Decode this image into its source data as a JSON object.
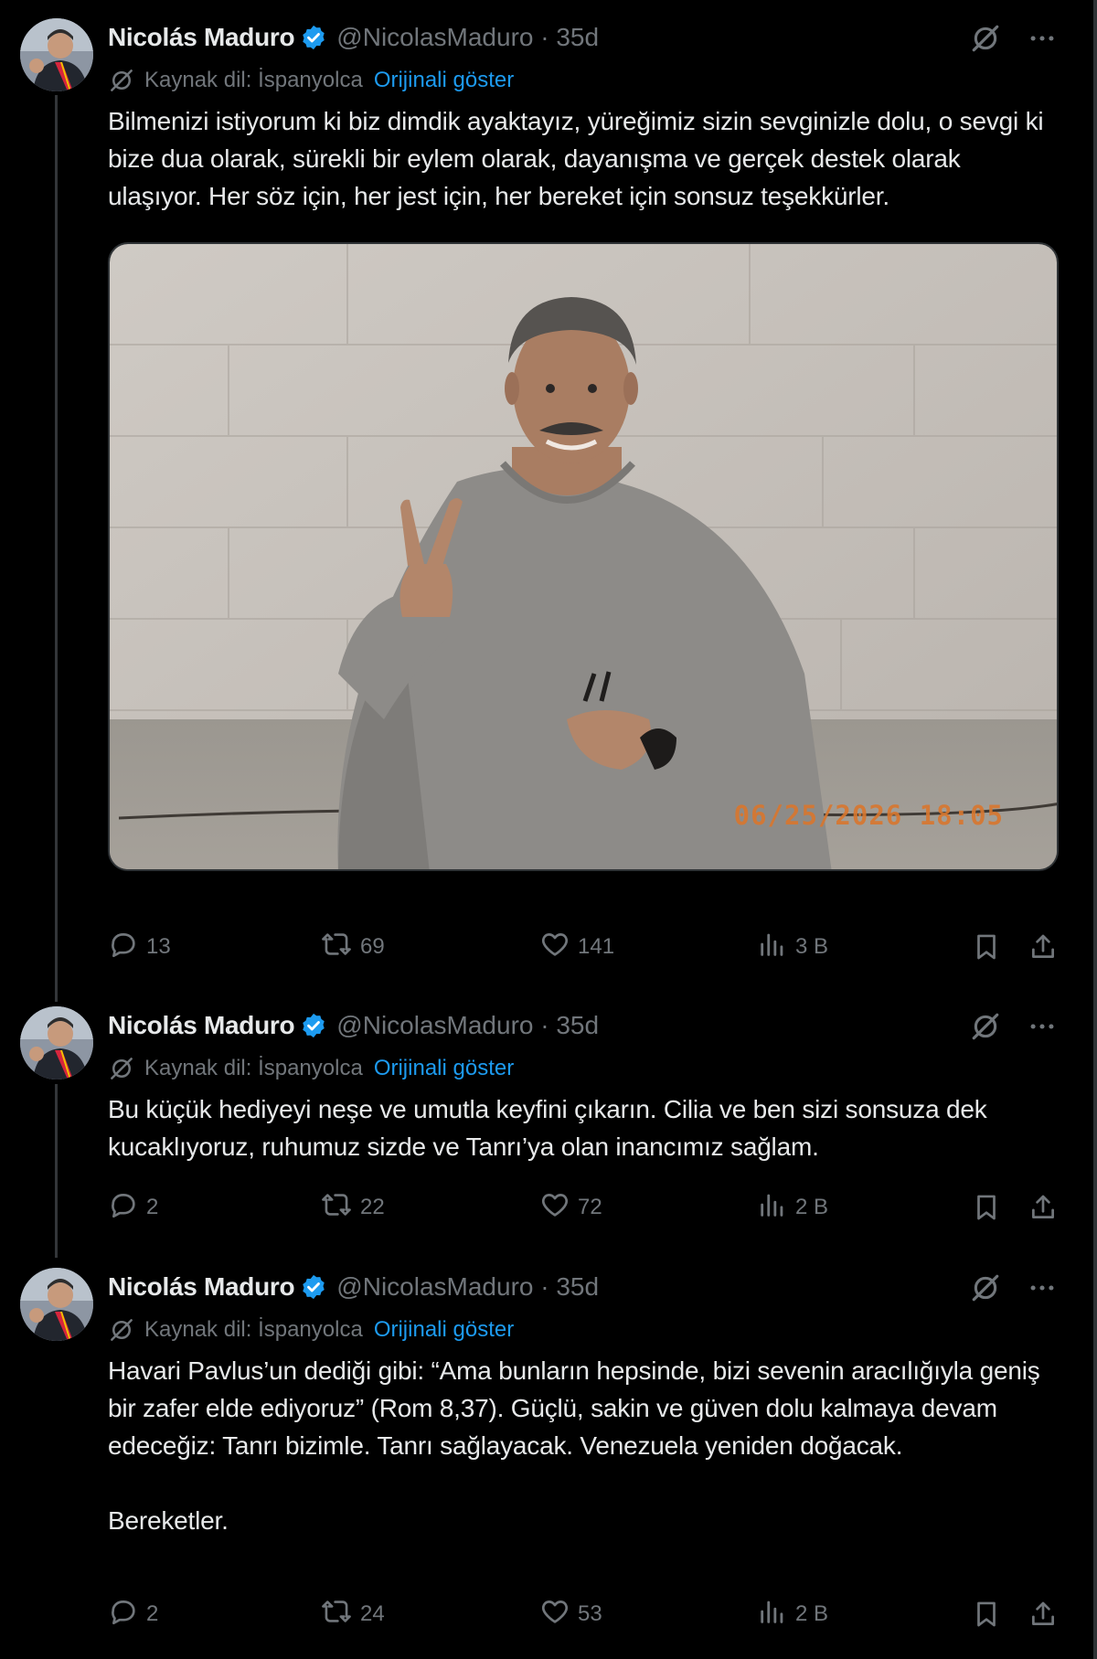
{
  "tweets": [
    {
      "name": "Nicolás Maduro",
      "handle": "@NicolasMaduro · 35d",
      "source_lang": "Kaynak dil: İspanyolca",
      "show_original": "Orijinali göster",
      "text": "Bilmenizi istiyorum ki biz dimdik ayaktayız, yüreğimiz sizin sevginizle dolu, o sevgi ki bize dua olarak, sürekli bir eylem olarak, dayanışma ve gerçek destek olarak ulaşıyor. Her söz için, her jest için, her bereket için sonsuz teşekkürler.",
      "media_stamp": "06/25/2026  18:05",
      "replies": "13",
      "reposts": "69",
      "likes": "141",
      "views": "3 B"
    },
    {
      "name": "Nicolás Maduro",
      "handle": "@NicolasMaduro · 35d",
      "source_lang": "Kaynak dil: İspanyolca",
      "show_original": "Orijinali göster",
      "text": "Bu küçük hediyeyi neşe ve umutla keyfini çıkarın. Cilia ve ben sizi sonsuza dek kucaklıyoruz, ruhumuz sizde ve Tanrı’ya olan inancımız sağlam.",
      "replies": "2",
      "reposts": "22",
      "likes": "72",
      "views": "2 B"
    },
    {
      "name": "Nicolás Maduro",
      "handle": "@NicolasMaduro · 35d",
      "source_lang": "Kaynak dil: İspanyolca",
      "show_original": "Orijinali göster",
      "text": "Havari Pavlus’un dediği gibi: “Ama bunların hepsinde, bizi sevenin aracılığıyla geniş bir zafer elde ediyoruz” (Rom 8,37). Güçlü, sakin ve güven dolu kalmaya devam edeceğiz: Tanrı bizimle. Tanrı sağlayacak. Venezuela yeniden doğacak.\n\nBereketler.",
      "replies": "2",
      "reposts": "24",
      "likes": "53",
      "views": "2 B"
    }
  ],
  "colors": {
    "background": "#000000",
    "text": "#e7e9ea",
    "muted": "#71767b",
    "link": "#1d9bf0",
    "verified": "#1d9bf0"
  },
  "icons": [
    "verified-badge-icon",
    "grok-slash-icon",
    "more-icon",
    "translate-icon",
    "reply-icon",
    "repost-icon",
    "like-icon",
    "views-icon",
    "bookmark-icon",
    "share-icon"
  ]
}
